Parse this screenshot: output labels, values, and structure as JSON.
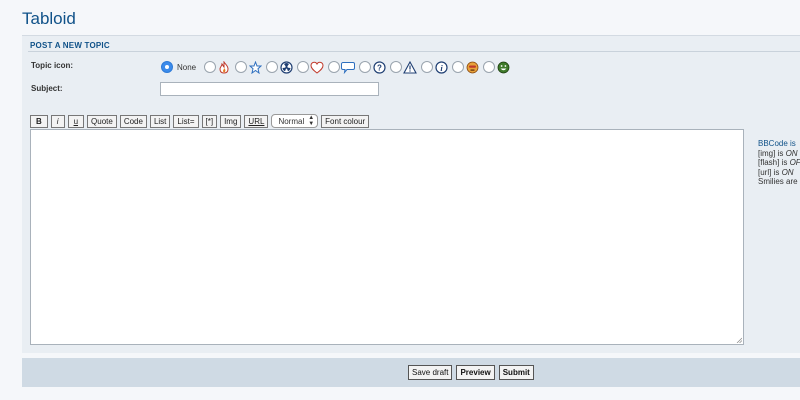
{
  "forum": {
    "title": "Tabloid"
  },
  "form": {
    "heading": "POST A NEW TOPIC",
    "topic_icon_label": "Topic icon:",
    "icon_none_label": "None",
    "subject_label": "Subject:",
    "subject_value": "",
    "icons": [
      "flame-icon",
      "star-icon",
      "radioactive-icon",
      "heart-icon",
      "speech-bubble-icon",
      "question-icon",
      "warning-icon",
      "info-icon",
      "mad-face-icon",
      "grin-face-icon"
    ]
  },
  "toolbar": {
    "bold": "B",
    "italic": "i",
    "underline": "u",
    "quote": "Quote",
    "code": "Code",
    "list": "List",
    "list_ordered": "List=",
    "list_item": "[*]",
    "img": "Img",
    "url": "URL",
    "font_size": "Normal",
    "font_colour": "Font colour"
  },
  "bbcode_info": {
    "bbcode": "BBCode is",
    "img_prefix": "[img] is ",
    "img_state": "ON",
    "flash_prefix": "[flash] is ",
    "flash_state": "OF",
    "url_prefix": "[url] is ",
    "url_state": "ON",
    "smilies": "Smilies are"
  },
  "actions": {
    "save_draft": "Save draft",
    "preview": "Preview",
    "submit": "Submit"
  },
  "colors": {
    "accent": "#105289",
    "panel": "#e9eef3",
    "footer": "#cfdae4"
  }
}
